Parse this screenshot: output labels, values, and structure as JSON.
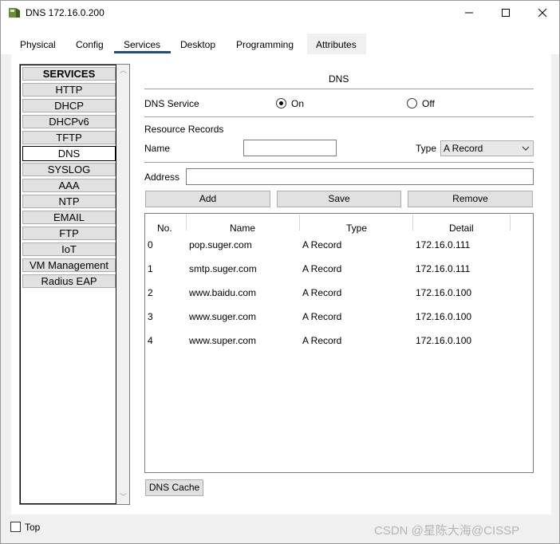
{
  "window": {
    "title": "DNS 172.16.0.200",
    "minimize_glyph": "—",
    "maximize_glyph": "☐",
    "close_glyph": "✕"
  },
  "tabs": [
    {
      "label": "Physical"
    },
    {
      "label": "Config"
    },
    {
      "label": "Services"
    },
    {
      "label": "Desktop"
    },
    {
      "label": "Programming"
    },
    {
      "label": "Attributes"
    }
  ],
  "active_tab": "Services",
  "services": {
    "header": "SERVICES",
    "items": [
      {
        "label": "HTTP"
      },
      {
        "label": "DHCP"
      },
      {
        "label": "DHCPv6"
      },
      {
        "label": "TFTP"
      },
      {
        "label": "DNS"
      },
      {
        "label": "SYSLOG"
      },
      {
        "label": "AAA"
      },
      {
        "label": "NTP"
      },
      {
        "label": "EMAIL"
      },
      {
        "label": "FTP"
      },
      {
        "label": "IoT"
      },
      {
        "label": "VM Management"
      },
      {
        "label": "Radius EAP"
      }
    ],
    "selected": "DNS"
  },
  "dns": {
    "panel_title": "DNS",
    "service_label": "DNS Service",
    "on_label": "On",
    "off_label": "Off",
    "service_state": "On",
    "resource_records_label": "Resource Records",
    "name_label": "Name",
    "name_value": "",
    "type_label": "Type",
    "type_value": "A Record",
    "address_label": "Address",
    "address_value": "",
    "add_button": "Add",
    "save_button": "Save",
    "remove_button": "Remove",
    "dns_cache_button": "DNS Cache"
  },
  "records_table": {
    "columns": [
      "No.",
      "Name",
      "Type",
      "Detail"
    ],
    "rows": [
      {
        "no": "0",
        "name": "pop.suger.com",
        "type": "A Record",
        "detail": "172.16.0.111"
      },
      {
        "no": "1",
        "name": "smtp.suger.com",
        "type": "A Record",
        "detail": "172.16.0.111"
      },
      {
        "no": "2",
        "name": "www.baidu.com",
        "type": "A Record",
        "detail": "172.16.0.100"
      },
      {
        "no": "3",
        "name": "www.suger.com",
        "type": "A Record",
        "detail": "172.16.0.100"
      },
      {
        "no": "4",
        "name": "www.super.com",
        "type": "A Record",
        "detail": "172.16.0.100"
      }
    ]
  },
  "footer": {
    "top_label": "Top",
    "top_checked": false,
    "watermark": "CSDN @星陈大海@CISSP"
  }
}
